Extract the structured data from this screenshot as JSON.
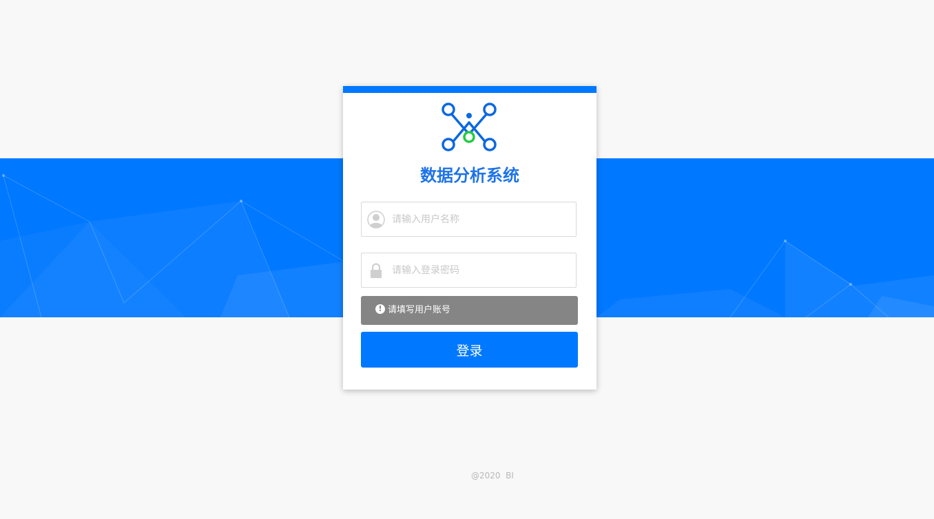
{
  "app": {
    "title": "数据分析系统"
  },
  "login": {
    "username_placeholder": "请输入用户名称",
    "username_value": "",
    "password_placeholder": "请输入登录密码",
    "password_value": "",
    "alert_text": "请填写用户账号",
    "alert_icon": "!",
    "submit_label": "登录"
  },
  "icons": {
    "logo": "network-nodes-logo-icon",
    "username": "user-avatar-icon",
    "password": "lock-icon",
    "alert": "exclamation-circle-icon"
  },
  "colors": {
    "brand": "#0078ff",
    "title": "#1e73e8",
    "logo_accent": "#22cc44",
    "alert_bg": "#858585",
    "page_bg": "#f8f8f8"
  },
  "footer": {
    "copyright": "@2020  BI"
  }
}
